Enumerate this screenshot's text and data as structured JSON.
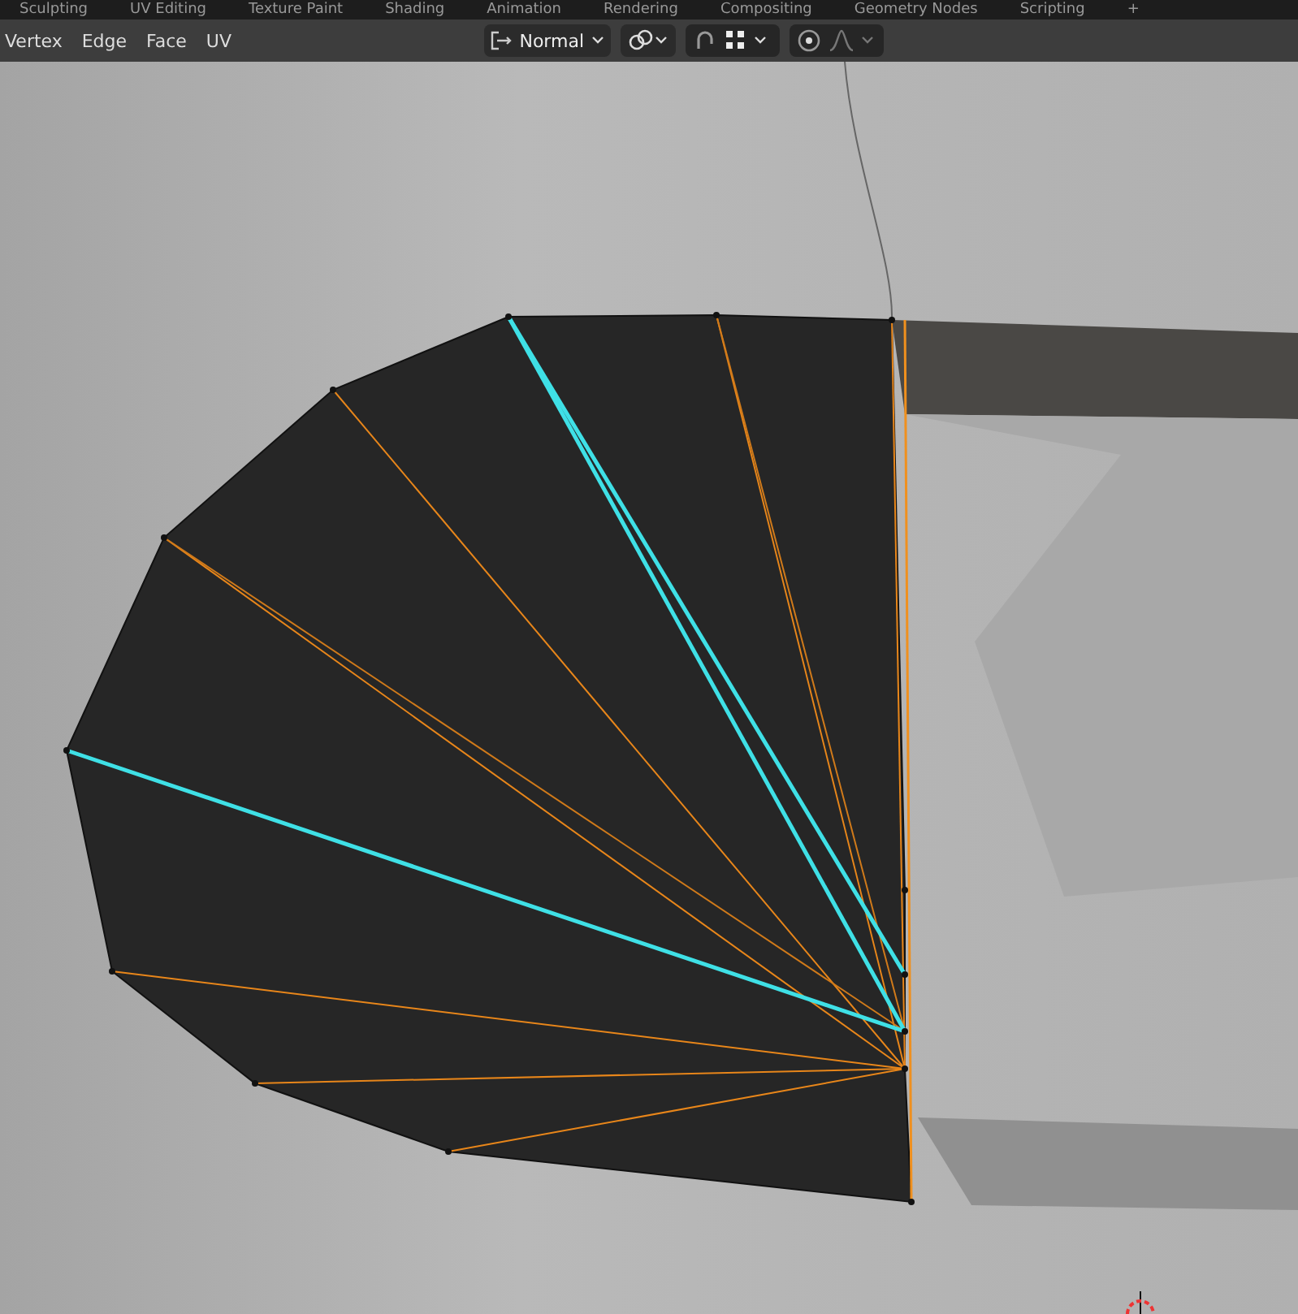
{
  "workspace_tabs": [
    "Sculpting",
    "UV Editing",
    "Texture Paint",
    "Shading",
    "Animation",
    "Rendering",
    "Compositing",
    "Geometry Nodes",
    "Scripting",
    "+"
  ],
  "header": {
    "select_menus": [
      "Vertex",
      "Edge",
      "Face",
      "UV"
    ],
    "transform_orientation": "Normal"
  }
}
